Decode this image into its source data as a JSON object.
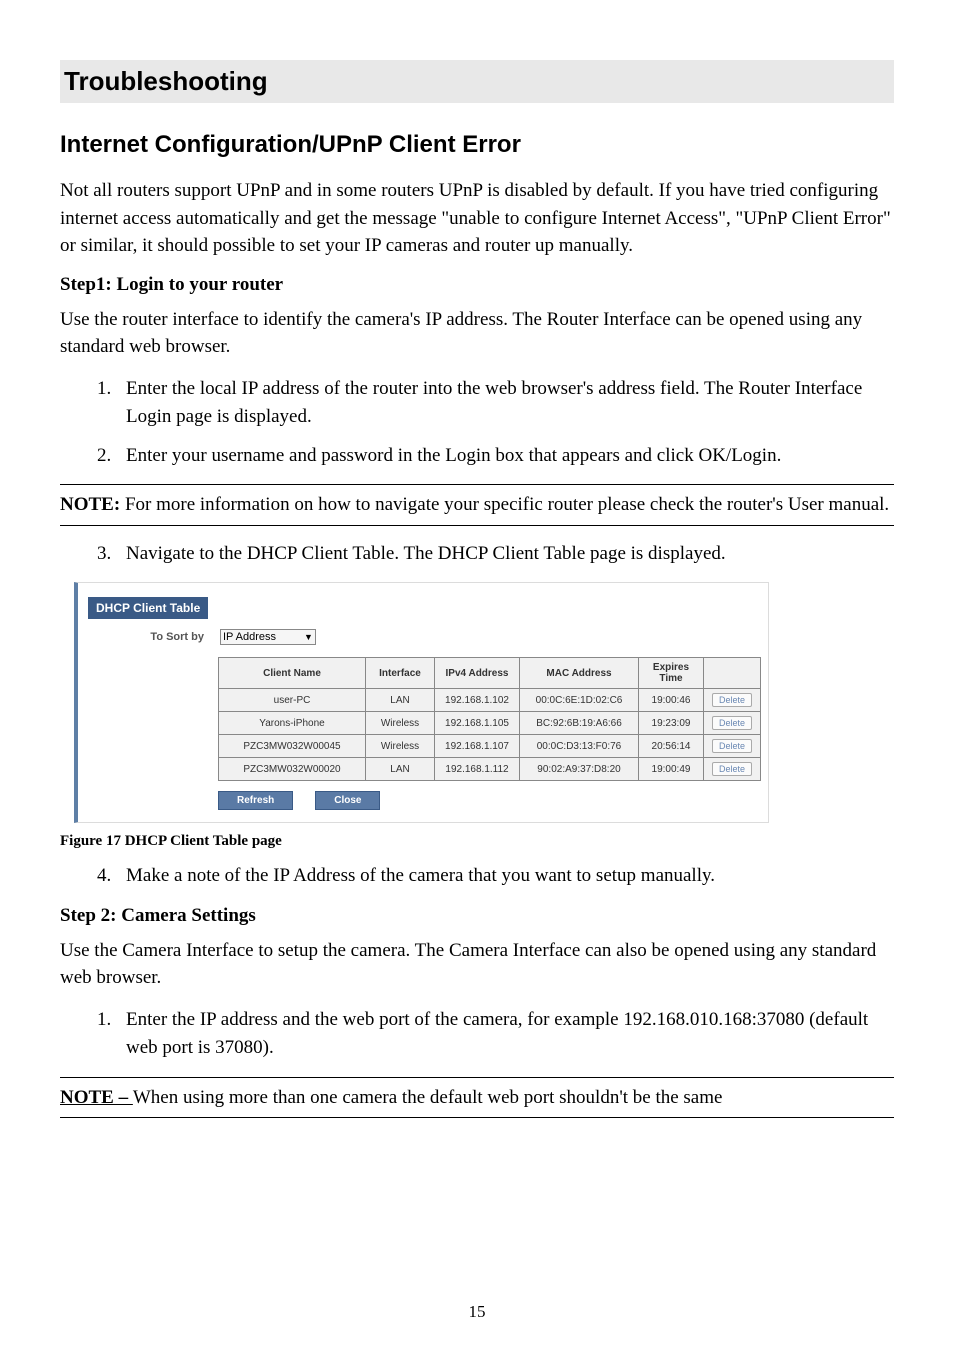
{
  "page": {
    "title": "Troubleshooting",
    "number": "15"
  },
  "section": {
    "heading": "Internet Configuration/UPnP Client Error",
    "intro": "Not all routers support UPnP and in some routers UPnP is disabled by default. If you have tried configuring internet access automatically and get the message \"unable to configure Internet Access\", \"UPnP Client Error\" or similar, it should possible to set your IP cameras and router up manually."
  },
  "step1": {
    "heading": "Step1: Login to your router",
    "intro": "Use the router interface to identify the camera's IP address. The Router Interface can be opened using any standard web browser.",
    "items": [
      "Enter the local IP address of the router into the web browser's address field. The Router Interface Login page is displayed.",
      "Enter your username and password in the Login box that appears and click OK/Login."
    ]
  },
  "note1": {
    "label": "NOTE:",
    "text": " For more information on how to navigate your specific router please check the router's User manual."
  },
  "step1b": {
    "item3": "Navigate to the DHCP Client Table. The DHCP Client Table page is displayed."
  },
  "dhcp": {
    "panel_title": "DHCP Client Table",
    "sort_label": "To Sort by",
    "sort_value": "IP Address",
    "columns": {
      "client": "Client Name",
      "iface": "Interface",
      "ip": "IPv4 Address",
      "mac": "MAC Address",
      "exp": "Expires Time"
    },
    "rows": [
      {
        "client": "user-PC",
        "iface": "LAN",
        "ip": "192.168.1.102",
        "mac": "00:0C:6E:1D:02:C6",
        "exp": "19:00:46"
      },
      {
        "client": "Yarons-iPhone",
        "iface": "Wireless",
        "ip": "192.168.1.105",
        "mac": "BC:92:6B:19:A6:66",
        "exp": "19:23:09"
      },
      {
        "client": "PZC3MW032W00045",
        "iface": "Wireless",
        "ip": "192.168.1.107",
        "mac": "00:0C:D3:13:F0:76",
        "exp": "20:56:14"
      },
      {
        "client": "PZC3MW032W00020",
        "iface": "LAN",
        "ip": "192.168.1.112",
        "mac": "90:02:A9:37:D8:20",
        "exp": "19:00:49"
      }
    ],
    "delete_label": "Delete",
    "refresh": "Refresh",
    "close": "Close"
  },
  "figure_caption": "Figure 17 DHCP Client Table page",
  "step1c": {
    "item4": "Make a note of the IP Address of the camera that you want to setup manually."
  },
  "step2": {
    "heading": "Step 2: Camera Settings",
    "intro": "Use the Camera Interface to setup the camera. The Camera Interface can also be opened using any standard web browser.",
    "item1": "Enter the IP address and the web port of the camera, for example 192.168.010.168:37080 (default web port is 37080)."
  },
  "note2": {
    "label": "NOTE – ",
    "text": "When using more than one camera the default web port shouldn't be the same"
  }
}
